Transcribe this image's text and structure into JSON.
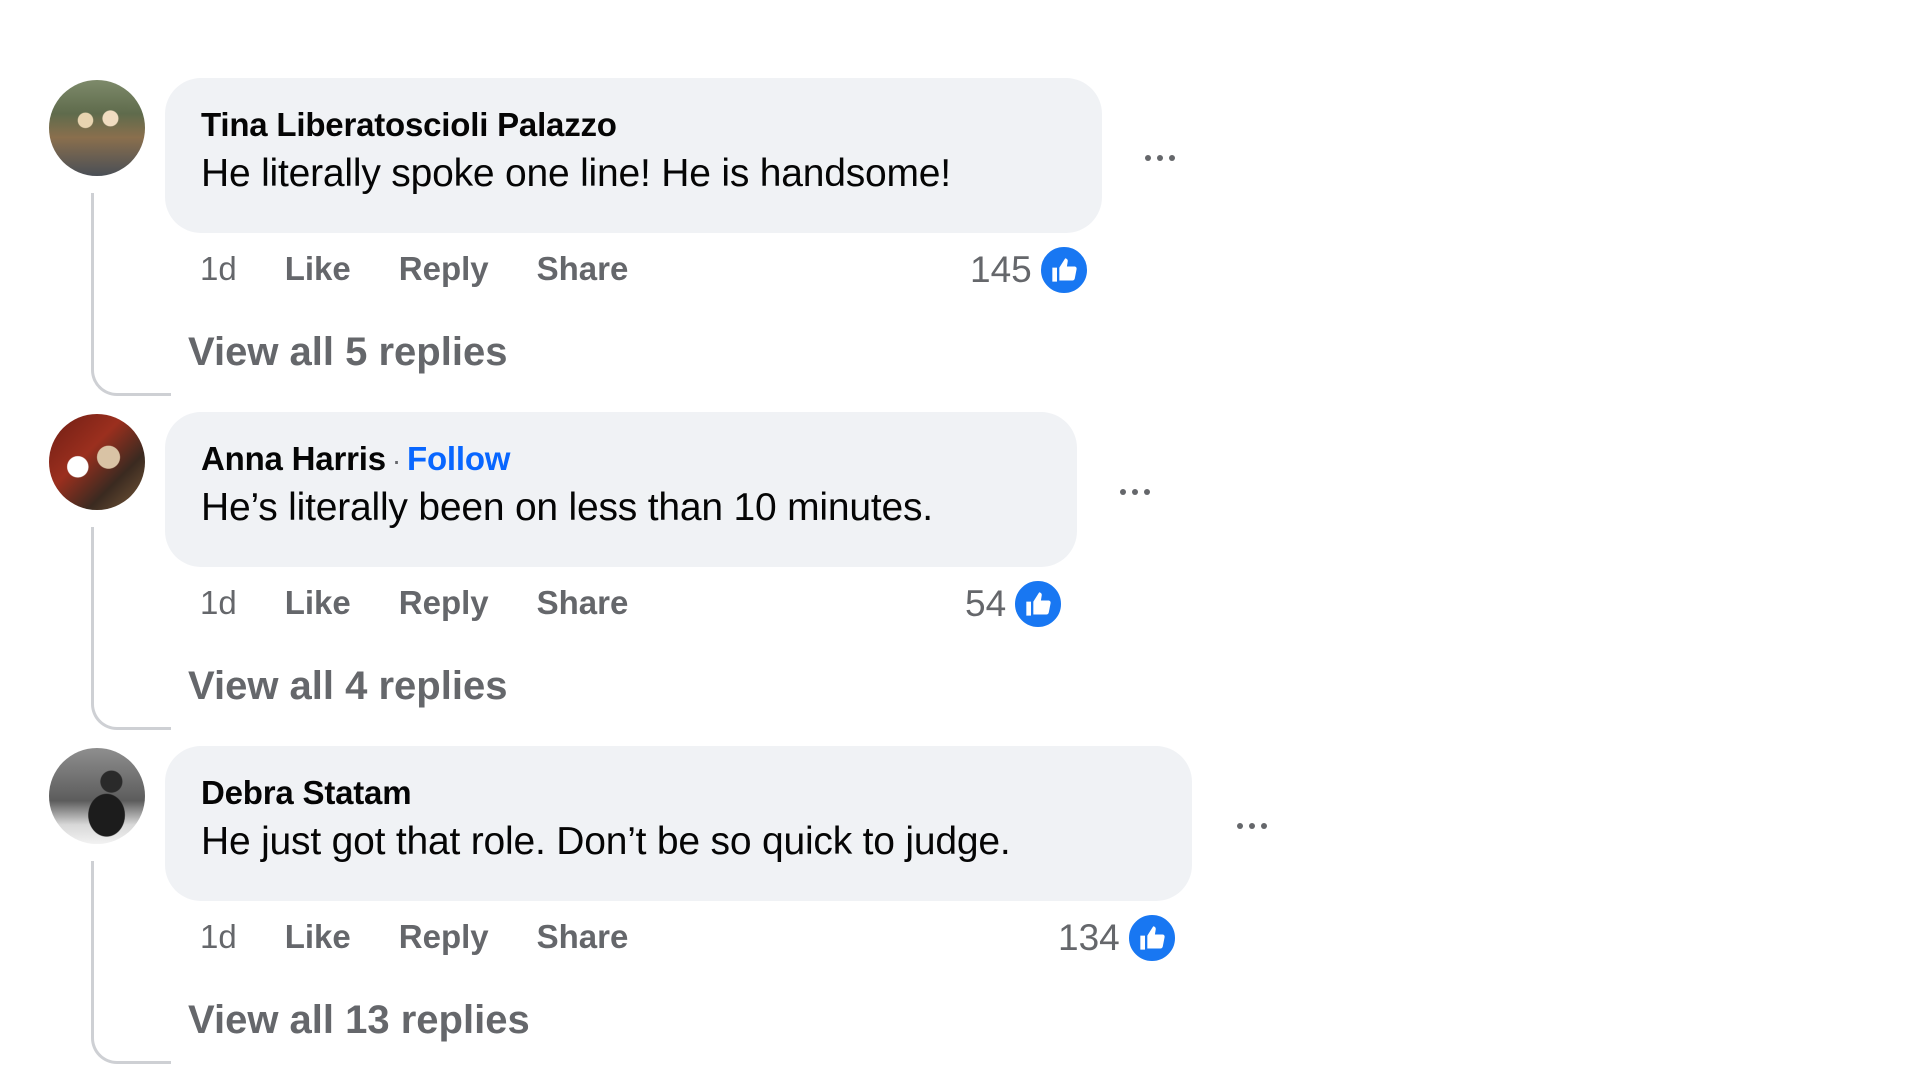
{
  "comments": [
    {
      "author": "Tina Liberatoscioli Palazzo",
      "follow": "",
      "text": "He literally spoke one line! He is handsome!",
      "time": "1d",
      "like_label": "Like",
      "reply_label": "Reply",
      "share_label": "Share",
      "reaction_count": "145",
      "reaction_icon": "like-icon",
      "view_replies": "View all 5 replies"
    },
    {
      "author": "Anna Harris",
      "separator": "·",
      "follow": "Follow",
      "text": "He’s literally been on less than 10 minutes.",
      "time": "1d",
      "like_label": "Like",
      "reply_label": "Reply",
      "share_label": "Share",
      "reaction_count": "54",
      "reaction_icon": "like-icon",
      "view_replies": "View all 4 replies"
    },
    {
      "author": "Debra Statam",
      "follow": "",
      "text": "He just got that role. Don’t be so quick to judge.",
      "time": "1d",
      "like_label": "Like",
      "reply_label": "Reply",
      "share_label": "Share",
      "reaction_count": "134",
      "reaction_icon": "like-icon",
      "view_replies": "View all 13 replies"
    }
  ],
  "colors": {
    "bubble": "#f0f2f5",
    "meta_text": "#65676b",
    "link": "#0866ff",
    "like_badge": "#1877f2"
  }
}
